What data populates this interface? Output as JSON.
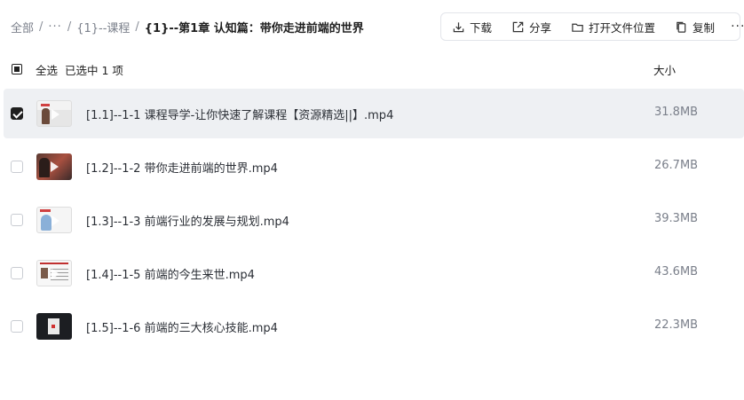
{
  "breadcrumb": {
    "root": "全部",
    "separator": "/",
    "ellipsis": "···",
    "parent": "{1}--课程",
    "current": "{1}--第1章 认知篇：带你走进前端的世界"
  },
  "toolbar": {
    "download": "下载",
    "share": "分享",
    "open_location": "打开文件位置",
    "copy": "复制",
    "more": "···"
  },
  "header": {
    "select_all": "全选",
    "selected_text": "已选中  1  项",
    "size_label": "大小"
  },
  "files": [
    {
      "name": "[1.1]--1-1 课程导学-让你快速了解课程【资源精选||】.mp4",
      "size": "31.8MB",
      "selected": true
    },
    {
      "name": "[1.2]--1-2 带你走进前端的世界.mp4",
      "size": "26.7MB",
      "selected": false
    },
    {
      "name": "[1.3]--1-3 前端行业的发展与规划.mp4",
      "size": "39.3MB",
      "selected": false
    },
    {
      "name": "[1.4]--1-5 前端的今生来世.mp4",
      "size": "43.6MB",
      "selected": false
    },
    {
      "name": "[1.5]--1-6 前端的三大核心技能.mp4",
      "size": "22.3MB",
      "selected": false
    }
  ],
  "icons": {
    "download": "download-icon",
    "share": "share-icon",
    "open_location": "folder-icon",
    "copy": "copy-icon"
  },
  "colors": {
    "selected_row_bg": "#eef0f3",
    "muted_text": "#7a7f8a",
    "checkbox_checked": "#1f1f1f"
  }
}
